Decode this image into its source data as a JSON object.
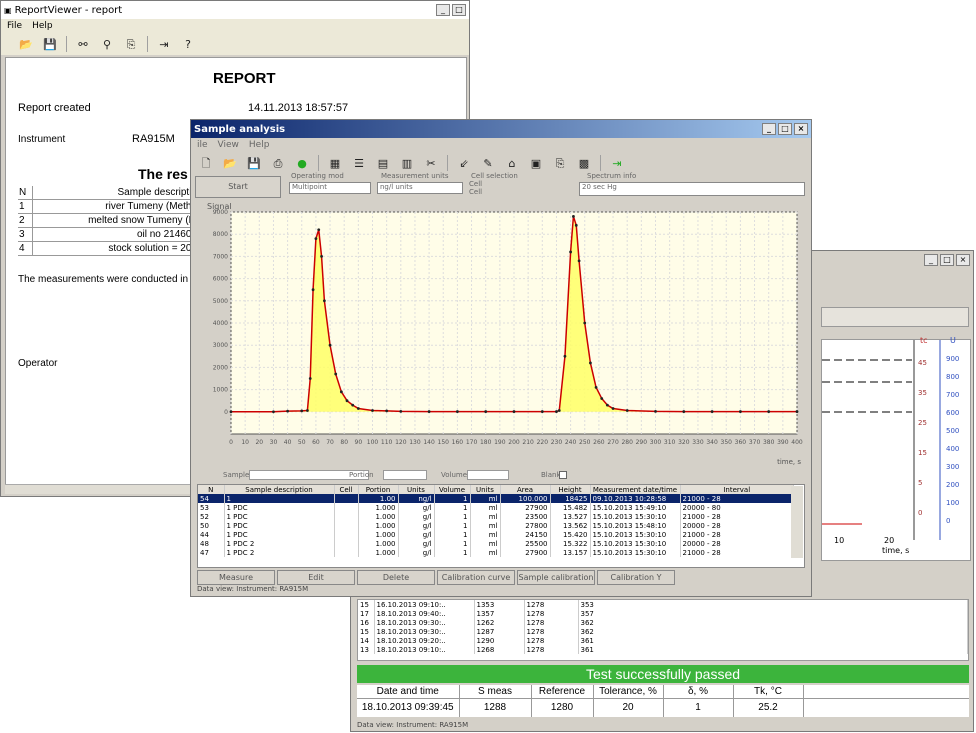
{
  "report_viewer": {
    "title": "ReportViewer - report",
    "menu": [
      "File",
      "Help"
    ],
    "toolbar_icons": [
      "open-icon",
      "save-icon",
      "binoculars-icon",
      "find-icon",
      "export-icon",
      "exit-icon",
      "help-icon"
    ],
    "heading": "REPORT",
    "report_created_label": "Report created",
    "report_created_value": "14.11.2013 18:57:57",
    "instrument_label": "Instrument",
    "instrument_value": "RA915M",
    "results_heading": "The res",
    "table_header_n": "N",
    "table_header_desc": "Sample descriptio",
    "rows": [
      {
        "n": "1",
        "desc": "river Tumeny (Metho"
      },
      {
        "n": "2",
        "desc": "melted snow Tumeny (M"
      },
      {
        "n": "3",
        "desc": "oil no 214602"
      },
      {
        "n": "4",
        "desc": "stock solution = 200"
      }
    ],
    "conducted_text": "The measurements were conducted in",
    "operator_label": "Operator"
  },
  "sample_analysis": {
    "title": "Sample analysis",
    "menu": [
      "ile",
      "View",
      "Help"
    ],
    "start_button": "Start",
    "group_operating": "Operating mod",
    "operating_value": "Multipoint",
    "group_measure": "Measurement units",
    "measure_value": "ng/l units",
    "group_cell": "Cell selection",
    "cell_line1": "Cell",
    "cell_line2": "Cell",
    "group_comment": "Spectrum info",
    "comment_value": "20 sec Hg",
    "chart_label": "Signal",
    "sample_label": "Sample",
    "mass_label": "Portion",
    "volume_label": "Volume",
    "blank_label": "Blank",
    "table_headers": [
      "N",
      "Sample description",
      "Cell",
      "Portion",
      "Units",
      "Volume",
      "Units",
      "Area",
      "Height",
      "Measurement date/time",
      "Interval"
    ],
    "table_rows": [
      [
        "54",
        "1",
        "",
        "1.00",
        "ng/l",
        "1",
        "ml",
        "100.000",
        "18425",
        "09.10.2013 10:28:58",
        "21000 - 28"
      ],
      [
        "53",
        "1 PDC",
        "",
        "1.000",
        "g/l",
        "1",
        "ml",
        "27900",
        "15.482",
        "15.10.2013 15:49:10",
        "20000 - 80"
      ],
      [
        "52",
        "1 PDC",
        "",
        "1.000",
        "g/l",
        "1",
        "ml",
        "23500",
        "13.527",
        "15.10.2013 15:30:10",
        "21000 - 28"
      ],
      [
        "50",
        "1 PDC",
        "",
        "1.000",
        "g/l",
        "1",
        "ml",
        "27800",
        "13.562",
        "15.10.2013 15:48:10",
        "20000 - 28"
      ],
      [
        "44",
        "1 PDC",
        "",
        "1.000",
        "g/l",
        "1",
        "ml",
        "24150",
        "15.420",
        "15.10.2013 15:30:10",
        "21000 - 28"
      ],
      [
        "48",
        "1 PDC 2",
        "",
        "1.000",
        "g/l",
        "1",
        "ml",
        "25500",
        "15.322",
        "15.10.2013 15:30:10",
        "20000 - 28"
      ],
      [
        "47",
        "1 PDC 2",
        "",
        "1.000",
        "g/l",
        "1",
        "ml",
        "27900",
        "13.157",
        "15.10.2013 15:30:10",
        "21000 - 28"
      ]
    ],
    "bottom_buttons": [
      "Measure",
      "Edit",
      "Delete",
      "Calibration curve",
      "Sample calibration",
      "Calibration Y"
    ],
    "status": "Data view: Instrument: RA915M"
  },
  "test_window": {
    "log_rows": [
      [
        "15",
        "16.10.2013 09:10:..",
        "1353",
        "1278",
        "353"
      ],
      [
        "17",
        "18.10.2013 09:40:..",
        "1357",
        "1278",
        "357"
      ],
      [
        "16",
        "18.10.2013 09:30:..",
        "1262",
        "1278",
        "362"
      ],
      [
        "15",
        "18.10.2013 09:30:..",
        "1287",
        "1278",
        "362"
      ],
      [
        "14",
        "18.10.2013 09:20:..",
        "1290",
        "1278",
        "361"
      ],
      [
        "13",
        "18.10.2013 09:10:..",
        "1268",
        "1278",
        "361"
      ]
    ],
    "passed_banner": "Test successfully passed",
    "result_headers": [
      "Date and time",
      "S meas",
      "Reference",
      "Tolerance, %",
      "δ, %",
      "Tk, °C"
    ],
    "result_values": [
      "18.10.2013 09:39:45",
      "1288",
      "1280",
      "20",
      "1",
      "25.2"
    ],
    "axis_right_label": "U",
    "axis_right2_label": "tc",
    "time_label": "time, s",
    "time_ticks": [
      "10",
      "20"
    ],
    "right_ticks": [
      "900",
      "800",
      "700",
      "600",
      "500",
      "400",
      "300",
      "200",
      "100",
      "0"
    ],
    "left_ticks": [
      "45",
      "35",
      "25",
      "15",
      "5",
      "0"
    ],
    "status": "Data view: Instrument: RA915M"
  },
  "chart_data": {
    "type": "line",
    "title": "",
    "xlabel": "time, s",
    "ylabel": "Signal",
    "x_ticks": [
      "0",
      "10",
      "20",
      "30",
      "40",
      "50",
      "60",
      "70",
      "80",
      "90",
      "100",
      "110",
      "120",
      "130",
      "140",
      "150",
      "160",
      "170",
      "180",
      "190",
      "200",
      "210",
      "220",
      "230",
      "240",
      "250",
      "260",
      "270",
      "280",
      "290",
      "300",
      "310",
      "320",
      "330",
      "340",
      "350",
      "360",
      "370",
      "380",
      "390",
      "400"
    ],
    "y_ticks": [
      "0",
      "1000",
      "2000",
      "3000",
      "4000",
      "5000",
      "6000",
      "7000",
      "8000",
      "9000"
    ],
    "ylim": [
      -1000,
      9000
    ],
    "xlim": [
      0,
      400
    ],
    "series": [
      {
        "x": [
          0,
          30,
          40,
          50,
          54,
          56,
          58,
          60,
          62,
          64,
          66,
          70,
          74,
          78,
          82,
          86,
          90,
          100,
          110,
          120,
          140,
          160,
          180,
          200,
          220,
          230,
          232,
          236,
          240,
          242,
          244,
          246,
          250,
          254,
          258,
          262,
          266,
          270,
          280,
          300,
          320,
          340,
          360,
          380,
          400
        ],
        "y": [
          0,
          0,
          30,
          40,
          60,
          1500,
          5500,
          7800,
          8200,
          7000,
          5000,
          3000,
          1700,
          900,
          500,
          300,
          150,
          60,
          40,
          20,
          10,
          10,
          10,
          10,
          10,
          10,
          60,
          2500,
          7200,
          8800,
          8400,
          6800,
          4000,
          2200,
          1100,
          600,
          300,
          150,
          60,
          20,
          10,
          10,
          10,
          10,
          10
        ]
      }
    ],
    "grid": true
  }
}
